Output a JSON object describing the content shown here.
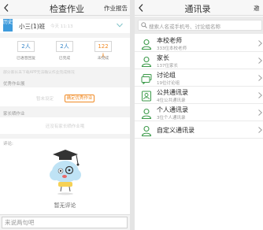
{
  "left": {
    "nav": {
      "title": "检查作业",
      "right": "作业报告"
    },
    "class_row": {
      "subject": "历史",
      "name": "小三(1)班",
      "time": "今天 11:13"
    },
    "stats": [
      {
        "value": "2人",
        "label": "已语音回复",
        "color": "blue"
      },
      {
        "value": "2人",
        "label": "已完成",
        "color": "blue"
      },
      {
        "value": "122人",
        "label": "未完成",
        "color": "orange"
      }
    ],
    "stats_note": "部分家长未下载APP无法确认作业完成情况",
    "excellent": {
      "label": "优秀作业展",
      "unset": "暂未设定",
      "button": "确定优秀作业"
    },
    "parent": {
      "label": "家长晒作业",
      "empty": "还没有家长晒作业哦"
    },
    "comment": {
      "label": "评论:",
      "empty": "暂无评论"
    },
    "input": {
      "placeholder": "来说两句吧"
    }
  },
  "right": {
    "nav": {
      "title": "通讯录",
      "right": "邀"
    },
    "search": {
      "placeholder": "搜索人名或手机号、讨论组名称"
    },
    "items": [
      {
        "title": "本校老师",
        "sub": "333位本校老师",
        "icon": "person-icon"
      },
      {
        "title": "家长",
        "sub": "137位家长",
        "icon": "person-icon"
      },
      {
        "title": "讨论组",
        "sub": "19位讨论组",
        "icon": "chat-group-icon"
      },
      {
        "title": "公共通讯录",
        "sub": "4位公共通讯录",
        "icon": "contact-card-icon"
      },
      {
        "title": "个人通讯录",
        "sub": "3位个人通讯录",
        "icon": "person-icon"
      },
      {
        "title": "自定义通讯录",
        "sub": "",
        "icon": "person-icon"
      }
    ]
  },
  "colors": {
    "accent_blue": "#3a87c8",
    "accent_orange": "#f08a24",
    "icon_green": "#3c9a4a"
  }
}
